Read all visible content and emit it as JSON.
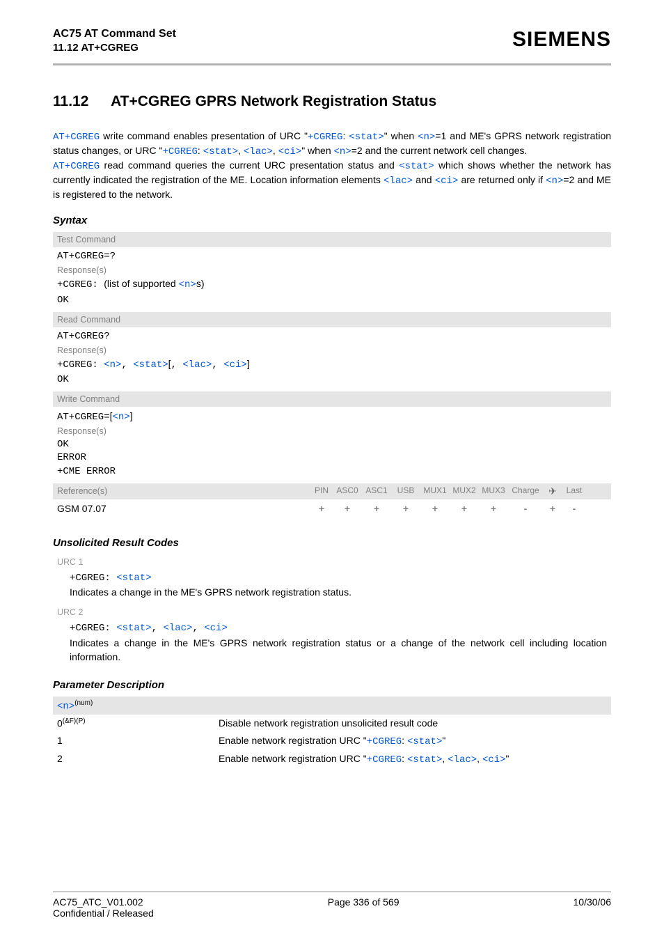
{
  "header": {
    "title": "AC75 AT Command Set",
    "subtitle": "11.12 AT+CGREG",
    "brand": "SIEMENS"
  },
  "section": {
    "number": "11.12",
    "title": "AT+CGREG   GPRS Network Registration Status"
  },
  "desc": {
    "l1a": "AT+CGREG",
    "l1b": " write command enables presentation of URC \"",
    "l1c": "+CGREG",
    "l1d": ": ",
    "l1e": "<stat>",
    "l1f": "\" when ",
    "l1g": "<n>",
    "l1h": "=1 and ME's GPRS network registration status changes, or URC \"",
    "l1i": "+CGREG",
    "l1j": ": ",
    "l1k": "<stat>",
    "l1l": ", ",
    "l1m": "<lac>",
    "l1n": ", ",
    "l1o": "<ci>",
    "l1p": "\" when ",
    "l1q": "<n>",
    "l1r": "=2 and the current network cell changes.",
    "l2a": "AT+CGREG",
    "l2b": " read command queries the current URC presentation status and ",
    "l2c": "<stat>",
    "l2d": " which shows whether the network has currently indicated the registration of the ME. Location information elements ",
    "l2e": "<lac>",
    "l2f": " and ",
    "l2g": "<ci>",
    "l2h": " are returned only if ",
    "l2i": "<n>",
    "l2j": "=2 and ME is registered to the network."
  },
  "syntax": {
    "heading": "Syntax",
    "test_label": "Test Command",
    "test_cmd": "AT+CGREG=?",
    "test_resp_label": "Response(s)",
    "test_resp_a": "+CGREG: ",
    "test_resp_b": "(list of supported ",
    "test_resp_c": "<n>",
    "test_resp_d": "s)",
    "test_resp_ok": "OK",
    "read_label": "Read Command",
    "read_cmd": "AT+CGREG?",
    "read_resp_label": "Response(s)",
    "read_resp_a": "+CGREG: ",
    "read_resp_b": "<n>",
    "read_resp_c": ", ",
    "read_resp_d": "<stat>",
    "read_resp_e": "[",
    "read_resp_f": ", ",
    "read_resp_g": "<lac>",
    "read_resp_h": ", ",
    "read_resp_i": "<ci>",
    "read_resp_j": "]",
    "read_resp_ok": "OK",
    "write_label": "Write Command",
    "write_cmd_a": "AT+CGREG=",
    "write_cmd_b": "[",
    "write_cmd_c": "<n>",
    "write_cmd_d": "]",
    "write_resp_label": "Response(s)",
    "write_resp_ok": "OK",
    "write_resp_err": "ERROR",
    "write_resp_cme": "+CME ERROR",
    "ref_label": "Reference(s)",
    "ref_cols": [
      "PIN",
      "ASC0",
      "ASC1",
      "USB",
      "MUX1",
      "MUX2",
      "MUX3",
      "Charge",
      "✈",
      "Last"
    ],
    "ref_val_label": "GSM 07.07",
    "ref_vals": [
      "+",
      "+",
      "+",
      "+",
      "+",
      "+",
      "+",
      "-",
      "+",
      "-"
    ]
  },
  "urc": {
    "heading": "Unsolicited Result Codes",
    "u1_label": "URC 1",
    "u1_a": "+CGREG: ",
    "u1_b": "<stat>",
    "u1_desc": "Indicates a change in the ME's GPRS network registration status.",
    "u2_label": "URC 2",
    "u2_a": "+CGREG: ",
    "u2_b": "<stat>",
    "u2_c": ", ",
    "u2_d": "<lac>",
    "u2_e": ", ",
    "u2_f": "<ci>",
    "u2_desc": "Indicates a change in the ME's GPRS network registration status or a change of the network cell including location information."
  },
  "params": {
    "heading": "Parameter Description",
    "head_a": "<n>",
    "head_b": "(num)",
    "r0_key_a": "0",
    "r0_key_b": "(&F)(P)",
    "r0_val": "Disable network registration unsolicited result code",
    "r1_key": "1",
    "r1_val_a": "Enable network registration URC \"",
    "r1_val_b": "+CGREG",
    "r1_val_c": ": ",
    "r1_val_d": "<stat>",
    "r1_val_e": "\"",
    "r2_key": "2",
    "r2_val_a": "Enable network registration URC \"",
    "r2_val_b": "+CGREG",
    "r2_val_c": ": ",
    "r2_val_d": "<stat>",
    "r2_val_e": ", ",
    "r2_val_f": "<lac>",
    "r2_val_g": ", ",
    "r2_val_h": "<ci>",
    "r2_val_i": "\""
  },
  "footer": {
    "doc": "AC75_ATC_V01.002",
    "conf": "Confidential / Released",
    "page": "Page 336 of 569",
    "date": "10/30/06"
  }
}
